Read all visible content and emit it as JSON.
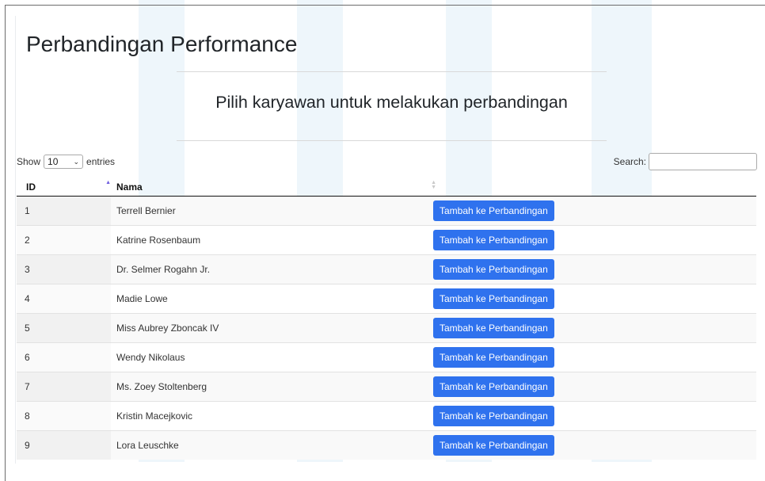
{
  "page": {
    "title": "Perbandingan Performance",
    "subtitle": "Pilih karyawan untuk melakukan perbandingan"
  },
  "length_control": {
    "show_label": "Show",
    "value": "10",
    "entries_label": "entries"
  },
  "search": {
    "label": "Search:",
    "value": ""
  },
  "table": {
    "columns": [
      "ID",
      "Nama",
      ""
    ],
    "sort_column": "ID",
    "rows": [
      {
        "id": "1",
        "nama": "Terrell Bernier",
        "action": "Tambah ke Perbandingan"
      },
      {
        "id": "2",
        "nama": "Katrine Rosenbaum",
        "action": "Tambah ke Perbandingan"
      },
      {
        "id": "3",
        "nama": "Dr. Selmer Rogahn Jr.",
        "action": "Tambah ke Perbandingan"
      },
      {
        "id": "4",
        "nama": "Madie Lowe",
        "action": "Tambah ke Perbandingan"
      },
      {
        "id": "5",
        "nama": "Miss Aubrey Zboncak IV",
        "action": "Tambah ke Perbandingan"
      },
      {
        "id": "6",
        "nama": "Wendy Nikolaus",
        "action": "Tambah ke Perbandingan"
      },
      {
        "id": "7",
        "nama": "Ms. Zoey Stoltenberg",
        "action": "Tambah ke Perbandingan"
      },
      {
        "id": "8",
        "nama": "Kristin Macejkovic",
        "action": "Tambah ke Perbandingan"
      },
      {
        "id": "9",
        "nama": "Lora Leuschke",
        "action": "Tambah ke Perbandingan"
      }
    ]
  },
  "colors": {
    "button": "#2f72ee",
    "sort_indicator_active": "#6f5de0",
    "watermark": "#eef6fb"
  }
}
